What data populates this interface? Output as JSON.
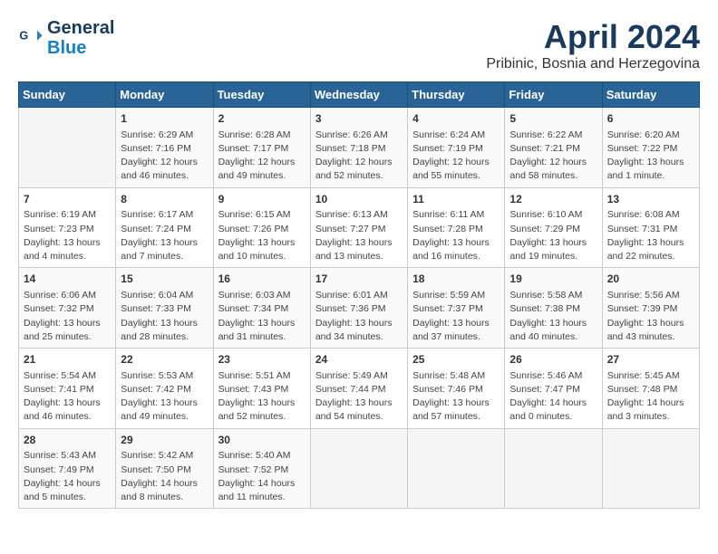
{
  "header": {
    "logo_line1": "General",
    "logo_line2": "Blue",
    "month": "April 2024",
    "location": "Pribinic, Bosnia and Herzegovina"
  },
  "weekdays": [
    "Sunday",
    "Monday",
    "Tuesday",
    "Wednesday",
    "Thursday",
    "Friday",
    "Saturday"
  ],
  "weeks": [
    [
      {
        "day": "",
        "info": ""
      },
      {
        "day": "1",
        "info": "Sunrise: 6:29 AM\nSunset: 7:16 PM\nDaylight: 12 hours\nand 46 minutes."
      },
      {
        "day": "2",
        "info": "Sunrise: 6:28 AM\nSunset: 7:17 PM\nDaylight: 12 hours\nand 49 minutes."
      },
      {
        "day": "3",
        "info": "Sunrise: 6:26 AM\nSunset: 7:18 PM\nDaylight: 12 hours\nand 52 minutes."
      },
      {
        "day": "4",
        "info": "Sunrise: 6:24 AM\nSunset: 7:19 PM\nDaylight: 12 hours\nand 55 minutes."
      },
      {
        "day": "5",
        "info": "Sunrise: 6:22 AM\nSunset: 7:21 PM\nDaylight: 12 hours\nand 58 minutes."
      },
      {
        "day": "6",
        "info": "Sunrise: 6:20 AM\nSunset: 7:22 PM\nDaylight: 13 hours\nand 1 minute."
      }
    ],
    [
      {
        "day": "7",
        "info": "Sunrise: 6:19 AM\nSunset: 7:23 PM\nDaylight: 13 hours\nand 4 minutes."
      },
      {
        "day": "8",
        "info": "Sunrise: 6:17 AM\nSunset: 7:24 PM\nDaylight: 13 hours\nand 7 minutes."
      },
      {
        "day": "9",
        "info": "Sunrise: 6:15 AM\nSunset: 7:26 PM\nDaylight: 13 hours\nand 10 minutes."
      },
      {
        "day": "10",
        "info": "Sunrise: 6:13 AM\nSunset: 7:27 PM\nDaylight: 13 hours\nand 13 minutes."
      },
      {
        "day": "11",
        "info": "Sunrise: 6:11 AM\nSunset: 7:28 PM\nDaylight: 13 hours\nand 16 minutes."
      },
      {
        "day": "12",
        "info": "Sunrise: 6:10 AM\nSunset: 7:29 PM\nDaylight: 13 hours\nand 19 minutes."
      },
      {
        "day": "13",
        "info": "Sunrise: 6:08 AM\nSunset: 7:31 PM\nDaylight: 13 hours\nand 22 minutes."
      }
    ],
    [
      {
        "day": "14",
        "info": "Sunrise: 6:06 AM\nSunset: 7:32 PM\nDaylight: 13 hours\nand 25 minutes."
      },
      {
        "day": "15",
        "info": "Sunrise: 6:04 AM\nSunset: 7:33 PM\nDaylight: 13 hours\nand 28 minutes."
      },
      {
        "day": "16",
        "info": "Sunrise: 6:03 AM\nSunset: 7:34 PM\nDaylight: 13 hours\nand 31 minutes."
      },
      {
        "day": "17",
        "info": "Sunrise: 6:01 AM\nSunset: 7:36 PM\nDaylight: 13 hours\nand 34 minutes."
      },
      {
        "day": "18",
        "info": "Sunrise: 5:59 AM\nSunset: 7:37 PM\nDaylight: 13 hours\nand 37 minutes."
      },
      {
        "day": "19",
        "info": "Sunrise: 5:58 AM\nSunset: 7:38 PM\nDaylight: 13 hours\nand 40 minutes."
      },
      {
        "day": "20",
        "info": "Sunrise: 5:56 AM\nSunset: 7:39 PM\nDaylight: 13 hours\nand 43 minutes."
      }
    ],
    [
      {
        "day": "21",
        "info": "Sunrise: 5:54 AM\nSunset: 7:41 PM\nDaylight: 13 hours\nand 46 minutes."
      },
      {
        "day": "22",
        "info": "Sunrise: 5:53 AM\nSunset: 7:42 PM\nDaylight: 13 hours\nand 49 minutes."
      },
      {
        "day": "23",
        "info": "Sunrise: 5:51 AM\nSunset: 7:43 PM\nDaylight: 13 hours\nand 52 minutes."
      },
      {
        "day": "24",
        "info": "Sunrise: 5:49 AM\nSunset: 7:44 PM\nDaylight: 13 hours\nand 54 minutes."
      },
      {
        "day": "25",
        "info": "Sunrise: 5:48 AM\nSunset: 7:46 PM\nDaylight: 13 hours\nand 57 minutes."
      },
      {
        "day": "26",
        "info": "Sunrise: 5:46 AM\nSunset: 7:47 PM\nDaylight: 14 hours\nand 0 minutes."
      },
      {
        "day": "27",
        "info": "Sunrise: 5:45 AM\nSunset: 7:48 PM\nDaylight: 14 hours\nand 3 minutes."
      }
    ],
    [
      {
        "day": "28",
        "info": "Sunrise: 5:43 AM\nSunset: 7:49 PM\nDaylight: 14 hours\nand 5 minutes."
      },
      {
        "day": "29",
        "info": "Sunrise: 5:42 AM\nSunset: 7:50 PM\nDaylight: 14 hours\nand 8 minutes."
      },
      {
        "day": "30",
        "info": "Sunrise: 5:40 AM\nSunset: 7:52 PM\nDaylight: 14 hours\nand 11 minutes."
      },
      {
        "day": "",
        "info": ""
      },
      {
        "day": "",
        "info": ""
      },
      {
        "day": "",
        "info": ""
      },
      {
        "day": "",
        "info": ""
      }
    ]
  ]
}
